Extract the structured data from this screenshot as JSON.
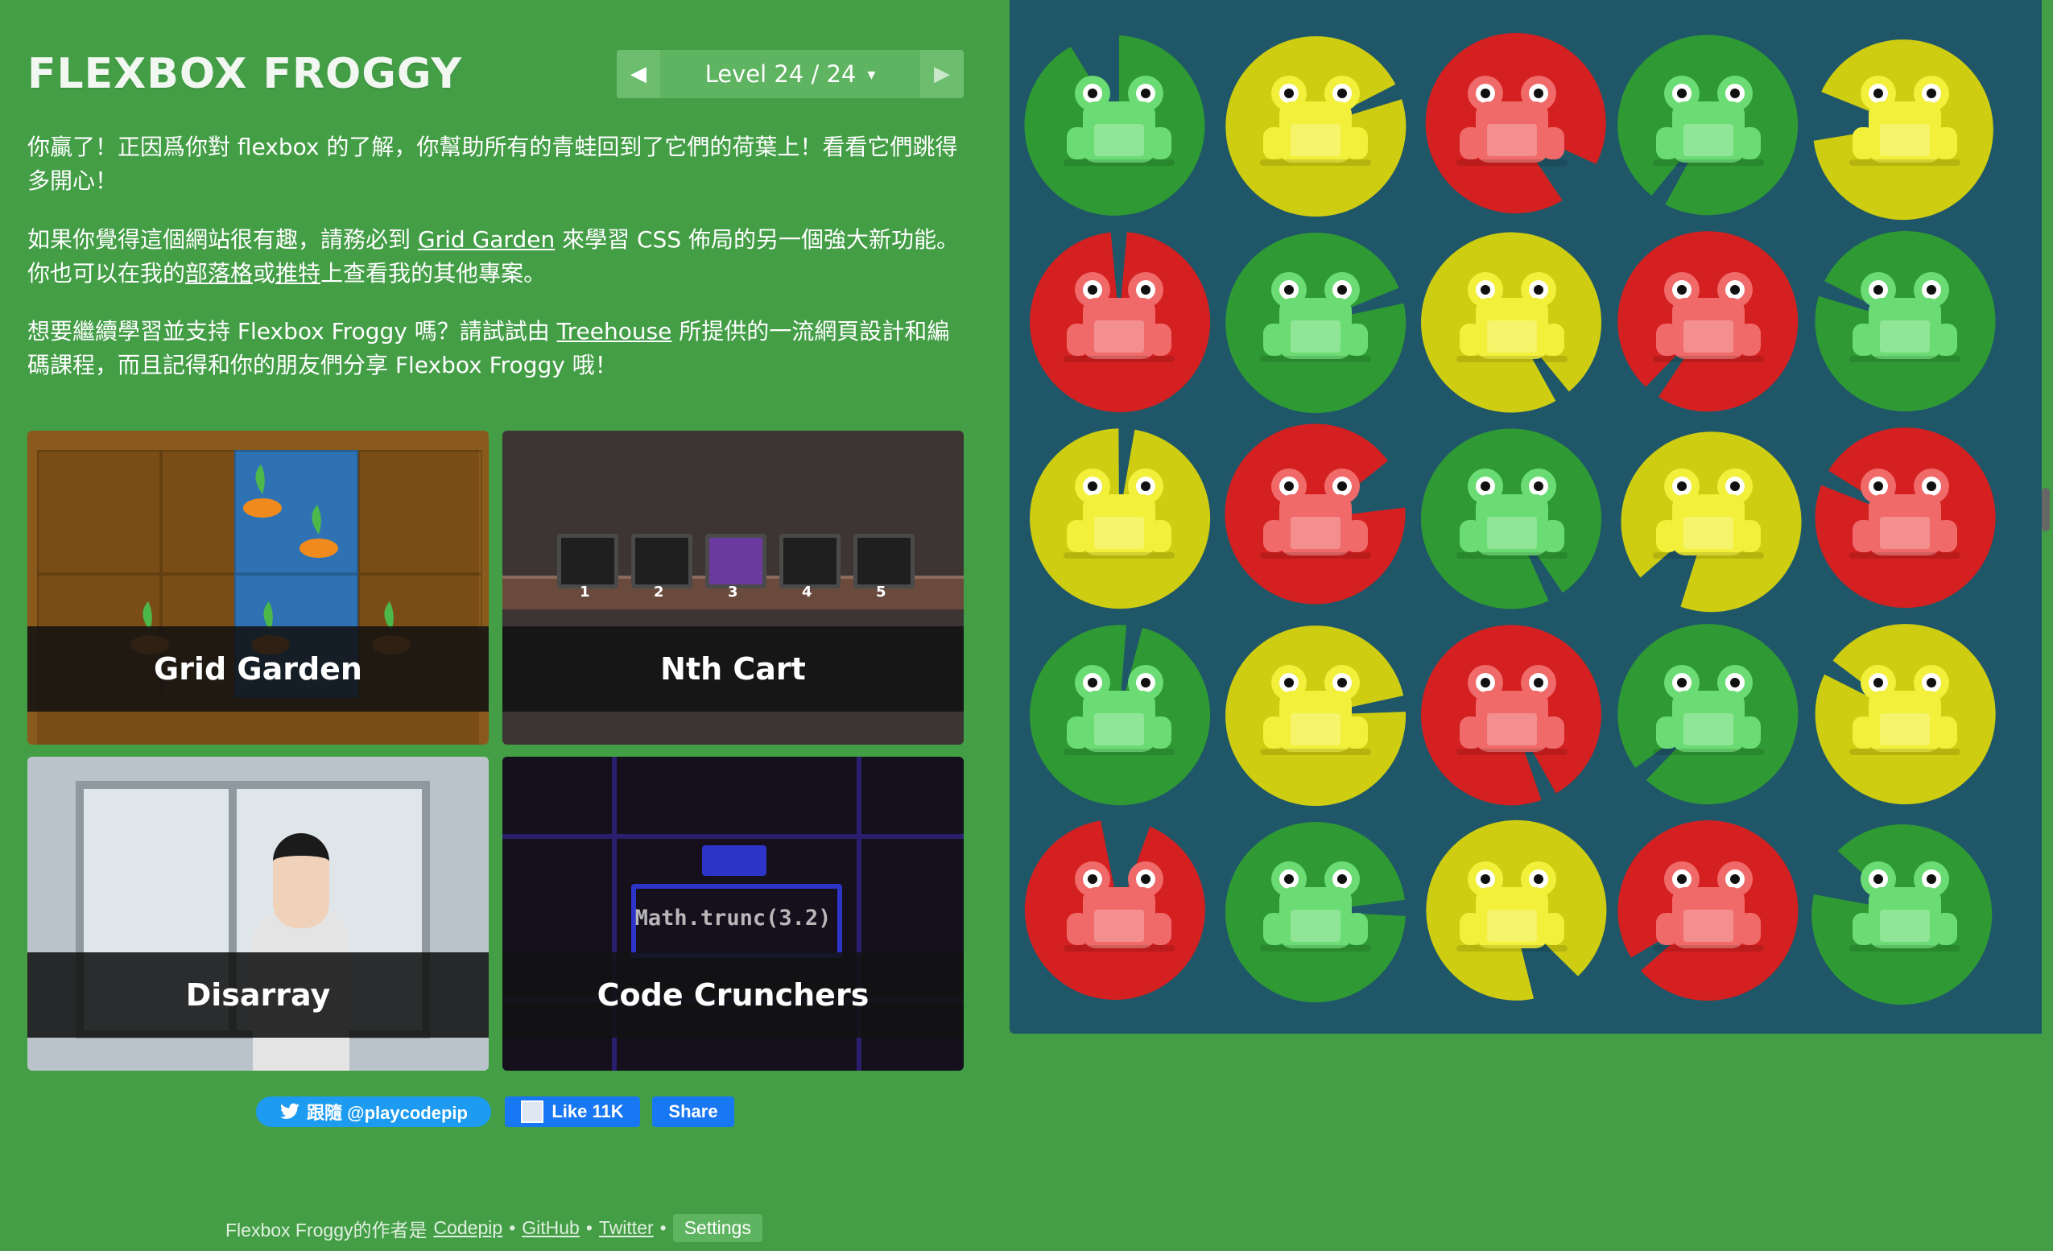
{
  "header": {
    "title": "FLEXBOX FROGGY",
    "level_label": "Level 24 / 24",
    "prev_arrow": "◀",
    "next_arrow": "▶",
    "caret": "▾"
  },
  "win_message": {
    "p1": "你贏了！正因爲你對 flexbox 的了解，你幫助所有的青蛙回到了它們的荷葉上！看看它們跳得多開心！",
    "p2_before": "如果你覺得這個網站很有趣，請務必到 ",
    "p2_link": "Grid Garden",
    "p2_mid": " 來學習 CSS 佈局的另一個強大新功能。你也可以在我的",
    "p2_link_blog": "部落格",
    "p2_or": "或",
    "p2_link_twitter": "推特",
    "p2_after": "上查看我的其他專案。",
    "p3_before": "想要繼續學習並支持 Flexbox Froggy 嗎？請試試由 ",
    "p3_link": "Treehouse",
    "p3_after": " 所提供的一流網頁設計和編碼課程，而且記得和你的朋友們分享 Flexbox Froggy 哦！"
  },
  "games": [
    {
      "name": "Grid Garden"
    },
    {
      "name": "Nth Cart"
    },
    {
      "name": "Disarray"
    },
    {
      "name": "Code Crunchers"
    }
  ],
  "nth_cart_numbers": [
    "1",
    "2",
    "3",
    "4",
    "5"
  ],
  "code_crunchers_code": "Math.trunc(3.2)",
  "social": {
    "twitter": "跟隨 @playcodepip",
    "fb_like": "Like 11K",
    "fb_share": "Share"
  },
  "footer": {
    "credit": "Flexbox Froggy的作者是",
    "codepip": "Codepip",
    "sep": "•",
    "github": "GitHub",
    "twitter": "Twitter",
    "settings": "Settings"
  },
  "pond": {
    "colors": {
      "green_pad": "#2f9a34",
      "green_frog": "#6bdc74",
      "yellow_pad": "#cfcd12",
      "yellow_frog": "#f2f03a",
      "red_pad": "#d42020",
      "red_frog": "#f06a6a",
      "water": "#1f5768"
    },
    "rows": [
      [
        "green",
        "yellow",
        "red",
        "green",
        "yellow"
      ],
      [
        "red",
        "green",
        "yellow",
        "red",
        "green"
      ],
      [
        "yellow",
        "red",
        "green",
        "yellow",
        "red"
      ],
      [
        "green",
        "yellow",
        "red",
        "green",
        "yellow"
      ],
      [
        "red",
        "green",
        "yellow",
        "red",
        "green"
      ]
    ]
  }
}
